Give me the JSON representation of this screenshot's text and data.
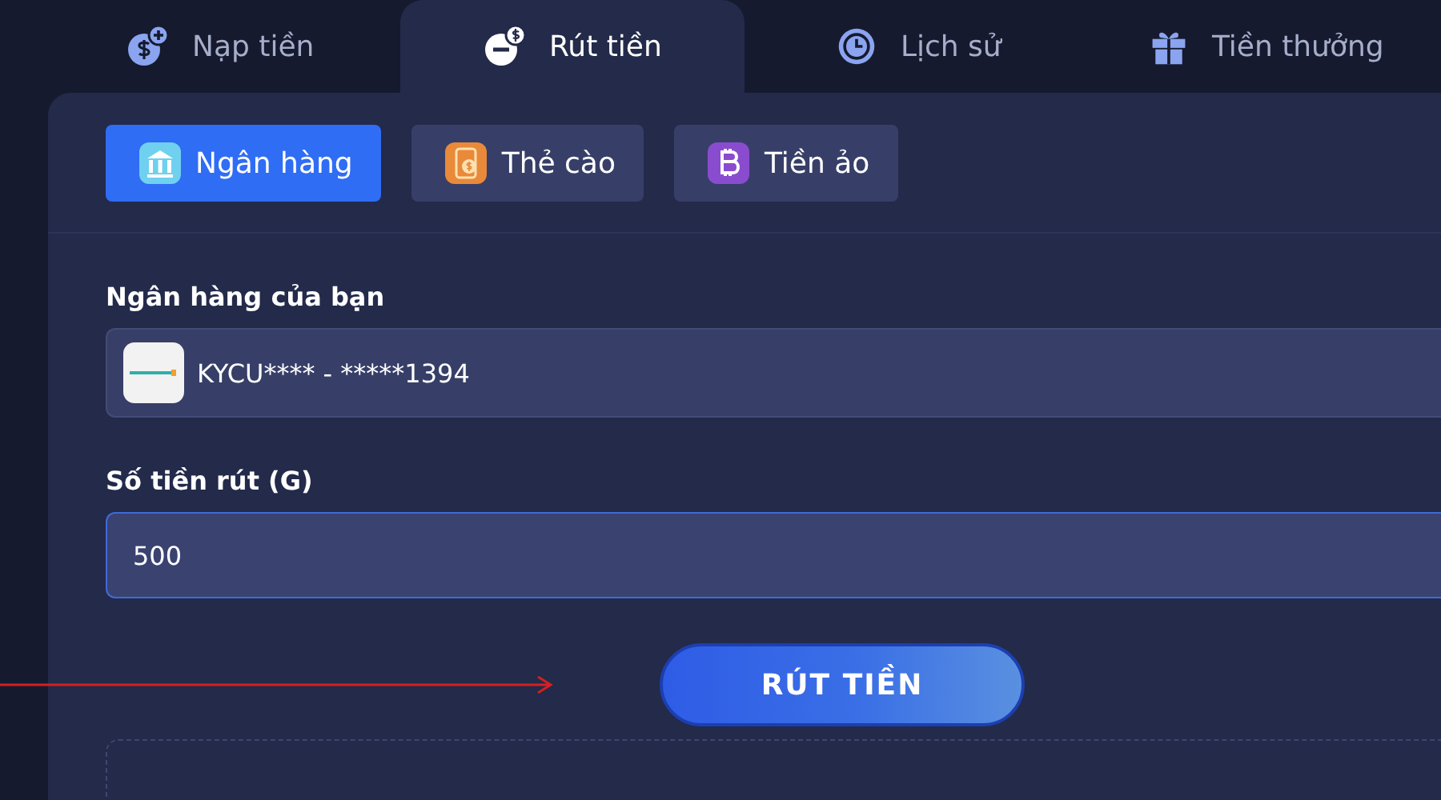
{
  "tabs": [
    {
      "label": "Nạp tiền",
      "selected": false
    },
    {
      "label": "Rút tiền",
      "selected": true
    },
    {
      "label": "Lịch sử",
      "selected": false
    },
    {
      "label": "Tiền thưởng",
      "selected": false
    }
  ],
  "methods": [
    {
      "label": "Ngân hàng",
      "selected": true
    },
    {
      "label": "Thẻ cào",
      "selected": false
    },
    {
      "label": "Tiền ảo",
      "selected": false
    }
  ],
  "bank": {
    "label": "Ngân hàng của bạn",
    "value": "KYCU**** - *****1394"
  },
  "amount": {
    "label": "Số tiền rút (G)",
    "value": "500"
  },
  "submit": "RÚT TIỀN"
}
